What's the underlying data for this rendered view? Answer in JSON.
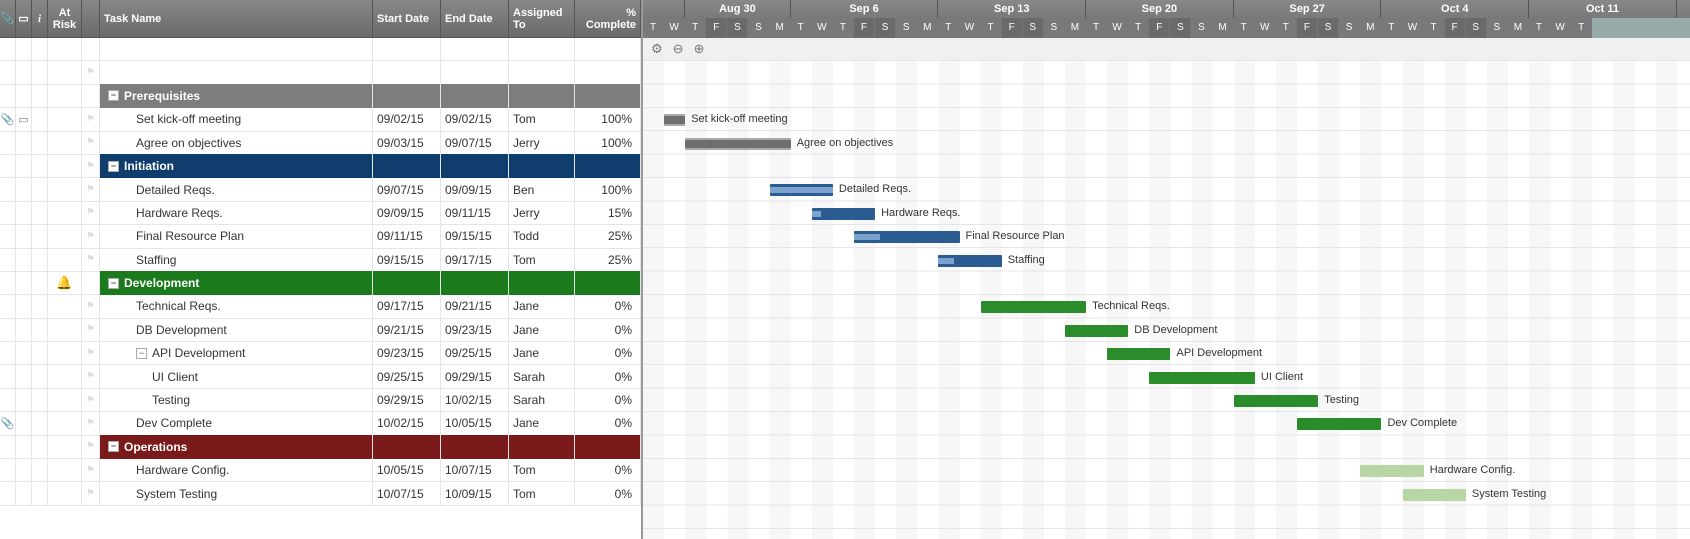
{
  "headers": {
    "at_risk": "At\nRisk",
    "task_name": "Task Name",
    "start_date": "Start\nDate",
    "end_date": "End Date",
    "assigned_to": "Assigned\nTo",
    "percent_complete": "%\nComplete"
  },
  "toolbar_icons": {
    "gear": "⚙",
    "zoom_out": "⊖",
    "zoom_in": "⊕"
  },
  "timeline": {
    "start_day_index": 2,
    "day_width": 21.1,
    "weeks": [
      "Aug 30",
      "Sep 6",
      "Sep 13",
      "Sep 20",
      "Sep 27",
      "Oct 4",
      "Oct 11"
    ],
    "days": [
      "T",
      "W",
      "T",
      "F",
      "S",
      "S",
      "M",
      "T",
      "W",
      "T",
      "F",
      "S",
      "S",
      "M",
      "T",
      "W",
      "T",
      "F",
      "S",
      "S",
      "M",
      "T",
      "W",
      "T",
      "F",
      "S",
      "S",
      "M",
      "T",
      "W",
      "T",
      "F",
      "S",
      "S",
      "M",
      "T",
      "W",
      "T",
      "F",
      "S",
      "S",
      "M",
      "T",
      "W",
      "T"
    ]
  },
  "rows": [
    {
      "type": "blank"
    },
    {
      "type": "blank",
      "flag": true
    },
    {
      "type": "section",
      "color": "gray",
      "label": "Prerequisites"
    },
    {
      "type": "task",
      "label": "Set kick-off meeting",
      "start": "09/02/15",
      "end": "09/02/15",
      "assignee": "Tom",
      "pct": "100%",
      "color": "gray",
      "indent": 2,
      "att": true,
      "com": true,
      "flag": true,
      "bar": {
        "startDay": 1,
        "durDays": 1,
        "progress": 100
      }
    },
    {
      "type": "task",
      "label": "Agree on objectives",
      "start": "09/03/15",
      "end": "09/07/15",
      "assignee": "Jerry",
      "pct": "100%",
      "color": "gray",
      "indent": 2,
      "flag": true,
      "bar": {
        "startDay": 2,
        "durDays": 5,
        "progress": 100
      }
    },
    {
      "type": "section",
      "color": "blue",
      "label": "Initiation",
      "flag": true
    },
    {
      "type": "task",
      "label": "Detailed Reqs.",
      "start": "09/07/15",
      "end": "09/09/15",
      "assignee": "Ben",
      "pct": "100%",
      "color": "blue",
      "indent": 2,
      "flag": true,
      "bar": {
        "startDay": 6,
        "durDays": 3,
        "progress": 100
      }
    },
    {
      "type": "task",
      "label": "Hardware Reqs.",
      "start": "09/09/15",
      "end": "09/11/15",
      "assignee": "Jerry",
      "pct": "15%",
      "color": "blue",
      "indent": 2,
      "flag": true,
      "bar": {
        "startDay": 8,
        "durDays": 3,
        "progress": 15
      }
    },
    {
      "type": "task",
      "label": "Final Resource Plan",
      "start": "09/11/15",
      "end": "09/15/15",
      "assignee": "Todd",
      "pct": "25%",
      "color": "blue",
      "indent": 2,
      "flag": true,
      "bar": {
        "startDay": 10,
        "durDays": 5,
        "progress": 25
      }
    },
    {
      "type": "task",
      "label": "Staffing",
      "start": "09/15/15",
      "end": "09/17/15",
      "assignee": "Tom",
      "pct": "25%",
      "color": "blue",
      "indent": 2,
      "flag": true,
      "bar": {
        "startDay": 14,
        "durDays": 3,
        "progress": 25
      }
    },
    {
      "type": "section",
      "color": "green",
      "label": "Development",
      "bell": true
    },
    {
      "type": "task",
      "label": "Technical Reqs.",
      "start": "09/17/15",
      "end": "09/21/15",
      "assignee": "Jane",
      "pct": "0%",
      "color": "green",
      "indent": 2,
      "flag": true,
      "bar": {
        "startDay": 16,
        "durDays": 5,
        "progress": 0
      }
    },
    {
      "type": "task",
      "label": "DB Development",
      "start": "09/21/15",
      "end": "09/23/15",
      "assignee": "Jane",
      "pct": "0%",
      "color": "green",
      "indent": 2,
      "flag": true,
      "bar": {
        "startDay": 20,
        "durDays": 3,
        "progress": 0
      }
    },
    {
      "type": "task",
      "label": "API Development",
      "start": "09/23/15",
      "end": "09/25/15",
      "assignee": "Jane",
      "pct": "0%",
      "color": "green",
      "indent": 2,
      "flag": true,
      "toggle": true,
      "bar": {
        "startDay": 22,
        "durDays": 3,
        "progress": 0
      }
    },
    {
      "type": "task",
      "label": "UI Client",
      "start": "09/25/15",
      "end": "09/29/15",
      "assignee": "Sarah",
      "pct": "0%",
      "color": "green",
      "indent": 3,
      "flag": true,
      "bar": {
        "startDay": 24,
        "durDays": 5,
        "progress": 0
      }
    },
    {
      "type": "task",
      "label": "Testing",
      "start": "09/29/15",
      "end": "10/02/15",
      "assignee": "Sarah",
      "pct": "0%",
      "color": "green",
      "indent": 3,
      "flag": true,
      "bar": {
        "startDay": 28,
        "durDays": 4,
        "progress": 0
      }
    },
    {
      "type": "task",
      "label": "Dev Complete",
      "start": "10/02/15",
      "end": "10/05/15",
      "assignee": "Jane",
      "pct": "0%",
      "color": "green",
      "indent": 2,
      "flag": true,
      "att": true,
      "bar": {
        "startDay": 31,
        "durDays": 4,
        "progress": 0
      }
    },
    {
      "type": "section",
      "color": "red",
      "label": "Operations",
      "flag": true
    },
    {
      "type": "task",
      "label": "Hardware Config.",
      "start": "10/05/15",
      "end": "10/07/15",
      "assignee": "Tom",
      "pct": "0%",
      "color": "lightgreen",
      "indent": 2,
      "flag": true,
      "bar": {
        "startDay": 34,
        "durDays": 3,
        "progress": 0
      }
    },
    {
      "type": "task",
      "label": "System Testing",
      "start": "10/07/15",
      "end": "10/09/15",
      "assignee": "Tom",
      "pct": "0%",
      "color": "lightgreen",
      "indent": 2,
      "flag": true,
      "bar": {
        "startDay": 36,
        "durDays": 3,
        "progress": 0
      }
    }
  ]
}
